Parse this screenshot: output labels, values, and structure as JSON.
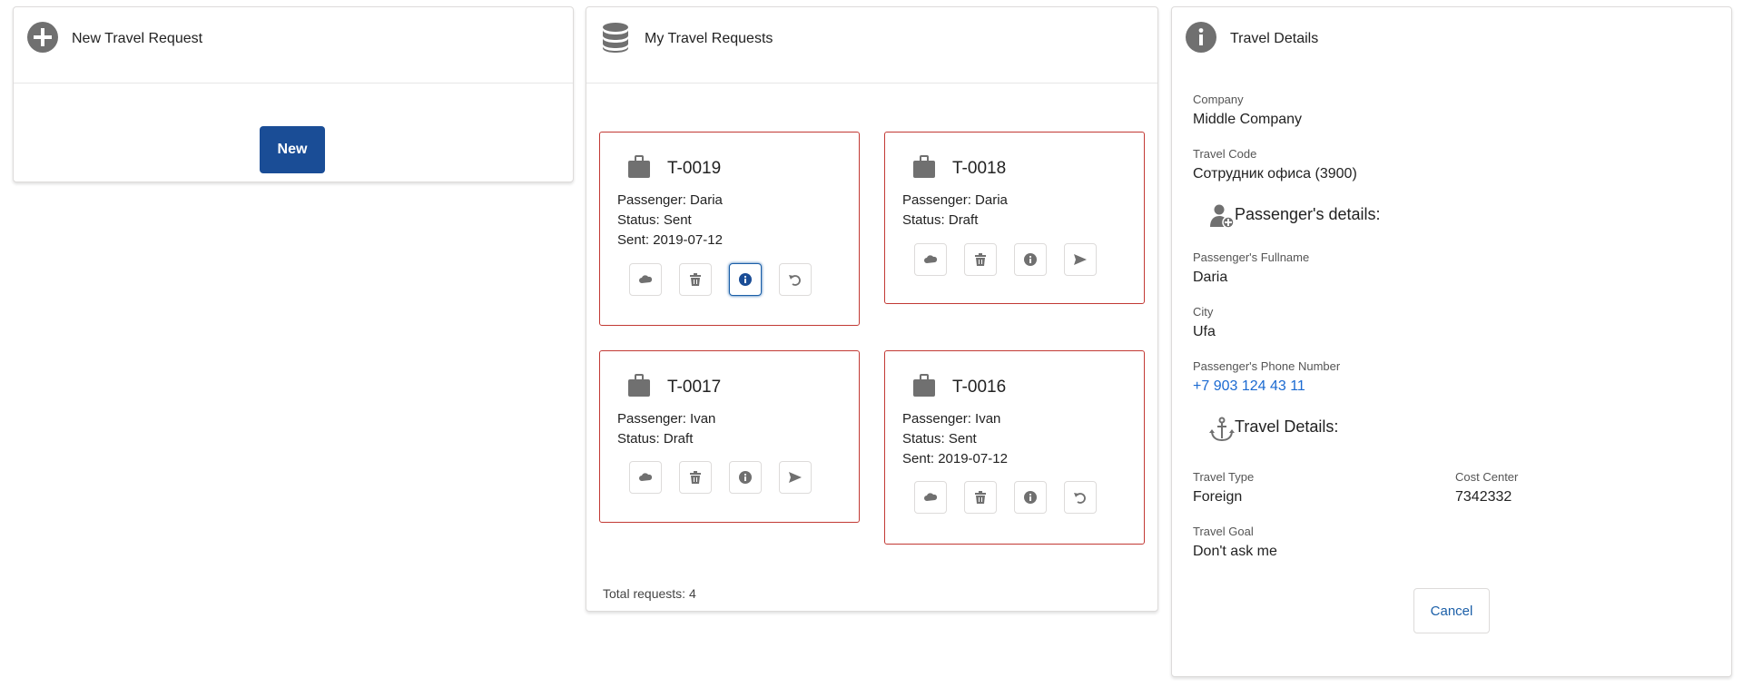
{
  "new_panel": {
    "title": "New Travel Request",
    "new_button": "New"
  },
  "list_panel": {
    "title": "My Travel Requests",
    "requests": [
      {
        "code": "T-0019",
        "passenger": "Passenger: Daria",
        "status": "Status: Sent",
        "sent": "Sent: 2019-07-12"
      },
      {
        "code": "T-0018",
        "passenger": "Passenger: Daria",
        "status": "Status: Draft"
      },
      {
        "code": "T-0017",
        "passenger": "Passenger: Ivan",
        "status": "Status: Draft"
      },
      {
        "code": "T-0016",
        "passenger": "Passenger: Ivan",
        "status": "Status: Sent",
        "sent": "Sent: 2019-07-12"
      }
    ],
    "total": "Total requests: 4"
  },
  "details_panel": {
    "title": "Travel Details",
    "company_label": "Company",
    "company": "Middle Company",
    "travel_code_label": "Travel Code",
    "travel_code": "Сотрудник офиса (3900)",
    "passenger_section": "Passenger's details:",
    "fullname_label": "Passenger's Fullname",
    "fullname": "Daria",
    "city_label": "City",
    "city": "Ufa",
    "phone_label": "Passenger's Phone Number",
    "phone": "+7 903 124 43 11",
    "travel_section": "Travel Details:",
    "travel_type_label": "Travel Type",
    "travel_type": "Foreign",
    "cost_center_label": "Cost Center",
    "cost_center": "7342332",
    "travel_goal_label": "Travel Goal",
    "travel_goal": "Don't ask me",
    "cancel_button": "Cancel"
  },
  "colors": {
    "brand": "#1a4d96",
    "tile_border": "#c23934",
    "link": "#1b6ad1",
    "icon": "#707070"
  },
  "icons": [
    "add-icon",
    "database-icon",
    "info-icon",
    "briefcase-icon",
    "cloud-icon",
    "trash-icon",
    "info-icon",
    "send-icon",
    "undo-icon",
    "add-user-icon",
    "anchor-icon"
  ]
}
